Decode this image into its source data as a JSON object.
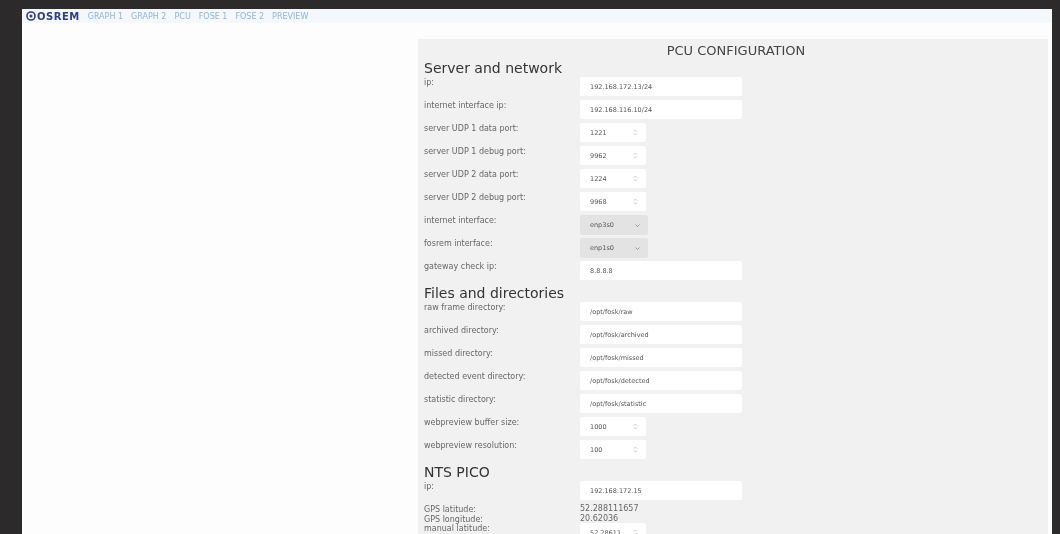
{
  "navbar": {
    "logo": "OSREM",
    "links": [
      "GRAPH 1",
      "GRAPH 2",
      "PCU",
      "FOSE 1",
      "FOSE 2",
      "PREVIEW"
    ]
  },
  "title": "PCU CONFIGURATION",
  "sections": [
    {
      "heading": "Server and network",
      "fields": [
        {
          "kind": "text",
          "label": "ip:",
          "value": "192.168.172.13/24"
        },
        {
          "kind": "text",
          "label": "internet interface ip:",
          "value": "192.168.116.10/24"
        },
        {
          "kind": "number",
          "label": "server UDP 1 data port:",
          "value": "1221"
        },
        {
          "kind": "number",
          "label": "server UDP 1 debug port:",
          "value": "9962"
        },
        {
          "kind": "number",
          "label": "server UDP 2 data port:",
          "value": "1224"
        },
        {
          "kind": "number",
          "label": "server UDP 2 debug port:",
          "value": "9968"
        },
        {
          "kind": "select",
          "label": "internet interface:",
          "value": "enp3s0"
        },
        {
          "kind": "select",
          "label": "fosrem interface:",
          "value": "enp1s0"
        },
        {
          "kind": "text",
          "label": "gateway check ip:",
          "value": "8.8.8.8"
        }
      ]
    },
    {
      "heading": "Files and directories",
      "fields": [
        {
          "kind": "text",
          "label": "raw frame directory:",
          "value": "/opt/fosk/raw"
        },
        {
          "kind": "text",
          "label": "archived directory:",
          "value": "/opt/fosk/archived"
        },
        {
          "kind": "text",
          "label": "missed directory:",
          "value": "/opt/fosk/missed"
        },
        {
          "kind": "text",
          "label": "detected event directory:",
          "value": "/opt/fosk/detected"
        },
        {
          "kind": "text",
          "label": "statistic directory:",
          "value": "/opt/fosk/statistic"
        },
        {
          "kind": "number",
          "label": "webpreview buffer size:",
          "value": "1000"
        },
        {
          "kind": "number",
          "label": "webpreview resolution:",
          "value": "100"
        }
      ]
    },
    {
      "heading": "NTS PICO",
      "fields": [
        {
          "kind": "text",
          "label": "ip:",
          "value": "192.168.172.15"
        },
        {
          "kind": "readonly",
          "label": "GPS latitude:",
          "value": "52.288111657"
        },
        {
          "kind": "readonly",
          "label": "GPS longitude:",
          "value": "20.62036"
        },
        {
          "kind": "number",
          "label": "manual latitude:",
          "value": "52.28611"
        }
      ]
    }
  ]
}
